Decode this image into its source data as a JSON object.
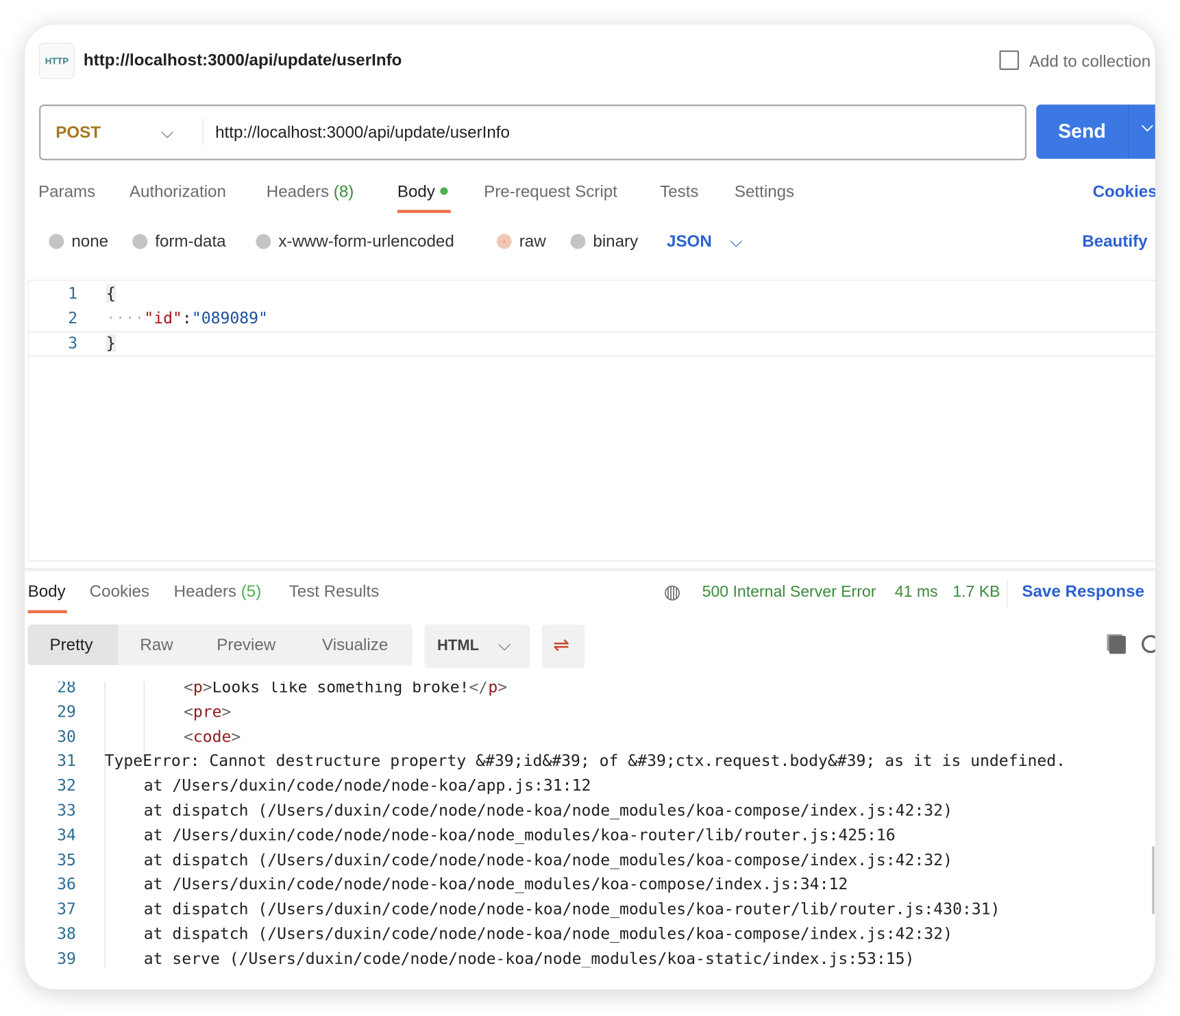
{
  "header": {
    "icon_label": "HTTP",
    "title": "http://localhost:3000/api/update/userInfo",
    "add_to_collection": "Add to collection"
  },
  "request": {
    "method": "POST",
    "url": "http://localhost:3000/api/update/userInfo",
    "send": "Send",
    "method_color": "#a5781f",
    "send_color": "#3b78e3"
  },
  "tabs": {
    "params": "Params",
    "authorization": "Authorization",
    "headers": "Headers",
    "headers_count": "(8)",
    "body": "Body",
    "prerequest": "Pre-request Script",
    "tests": "Tests",
    "settings": "Settings",
    "cookies": "Cookies"
  },
  "body_types": {
    "none": "none",
    "form_data": "form-data",
    "urlencoded": "x-www-form-urlencoded",
    "raw": "raw",
    "binary": "binary",
    "selected": "raw",
    "format": "JSON",
    "beautify": "Beautify"
  },
  "editor": {
    "lines": [
      {
        "n": "1",
        "text": "{"
      },
      {
        "n": "2",
        "key": "\"id\"",
        "colon": ":",
        "value": "\"089089\""
      },
      {
        "n": "3",
        "text": "}"
      }
    ]
  },
  "response": {
    "tabs": {
      "body": "Body",
      "cookies": "Cookies",
      "headers": "Headers",
      "headers_count": "(5)",
      "test_results": "Test Results"
    },
    "status": "500 Internal Server Error",
    "time": "41 ms",
    "size": "1.7 KB",
    "save": "Save Response",
    "views": {
      "pretty": "Pretty",
      "raw": "Raw",
      "preview": "Preview",
      "visualize": "Visualize",
      "format": "HTML"
    },
    "lines": [
      {
        "n": "28",
        "indent": 2,
        "text": "<p>Looks like something broke!</p>"
      },
      {
        "n": "29",
        "indent": 2,
        "text": "<pre>"
      },
      {
        "n": "30",
        "indent": 2,
        "text": "<code>"
      },
      {
        "n": "31",
        "indent": 0,
        "text": "TypeError: Cannot destructure property &#39;id&#39; of &#39;ctx.request.body&#39; as it is undefined."
      },
      {
        "n": "32",
        "indent": 1,
        "text": "at /Users/duxin/code/node/node-koa/app.js:31:12"
      },
      {
        "n": "33",
        "indent": 1,
        "text": "at dispatch (/Users/duxin/code/node/node-koa/node_modules/koa-compose/index.js:42:32)"
      },
      {
        "n": "34",
        "indent": 1,
        "text": "at /Users/duxin/code/node/node-koa/node_modules/koa-router/lib/router.js:425:16"
      },
      {
        "n": "35",
        "indent": 1,
        "text": "at dispatch (/Users/duxin/code/node/node-koa/node_modules/koa-compose/index.js:42:32)"
      },
      {
        "n": "36",
        "indent": 1,
        "text": "at /Users/duxin/code/node/node-koa/node_modules/koa-compose/index.js:34:12"
      },
      {
        "n": "37",
        "indent": 1,
        "text": "at dispatch (/Users/duxin/code/node/node-koa/node_modules/koa-router/lib/router.js:430:31)"
      },
      {
        "n": "38",
        "indent": 1,
        "text": "at dispatch (/Users/duxin/code/node/node-koa/node_modules/koa-compose/index.js:42:32)"
      },
      {
        "n": "39",
        "indent": 1,
        "text": "at serve (/Users/duxin/code/node/node-koa/node_modules/koa-static/index.js:53:15)"
      }
    ]
  },
  "colors": {
    "accent": "#ec6f43",
    "status": "#3b8a3b",
    "link": "#2b61d1"
  }
}
